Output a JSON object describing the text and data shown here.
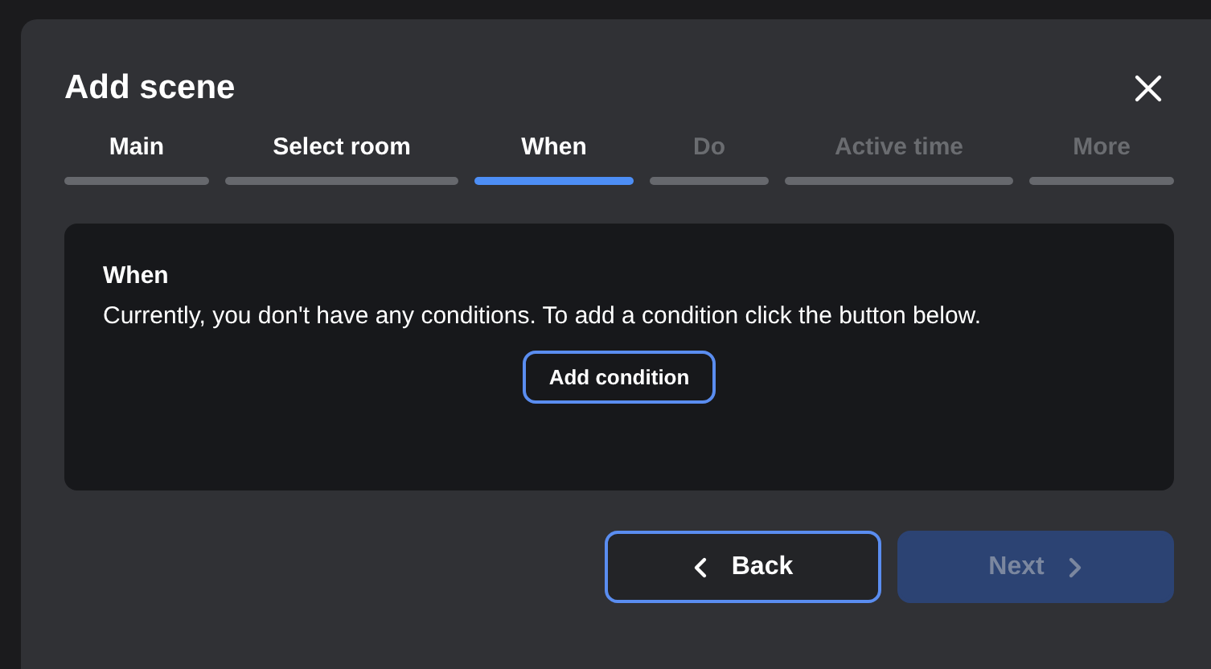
{
  "dialog": {
    "title": "Add scene"
  },
  "steps": [
    {
      "label": "Main",
      "selected": false,
      "disabled": false
    },
    {
      "label": "Select room",
      "selected": false,
      "disabled": false
    },
    {
      "label": "When",
      "selected": true,
      "disabled": false
    },
    {
      "label": "Do",
      "selected": false,
      "disabled": true
    },
    {
      "label": "Active time",
      "selected": false,
      "disabled": true
    },
    {
      "label": "More",
      "selected": false,
      "disabled": true
    }
  ],
  "section": {
    "heading": "When",
    "message": "Currently, you don't have any conditions. To add a condition click the button below.",
    "button": "Add condition"
  },
  "footer": {
    "back": {
      "label": "Back",
      "disabled": false
    },
    "next": {
      "label": "Next",
      "disabled": true
    }
  }
}
